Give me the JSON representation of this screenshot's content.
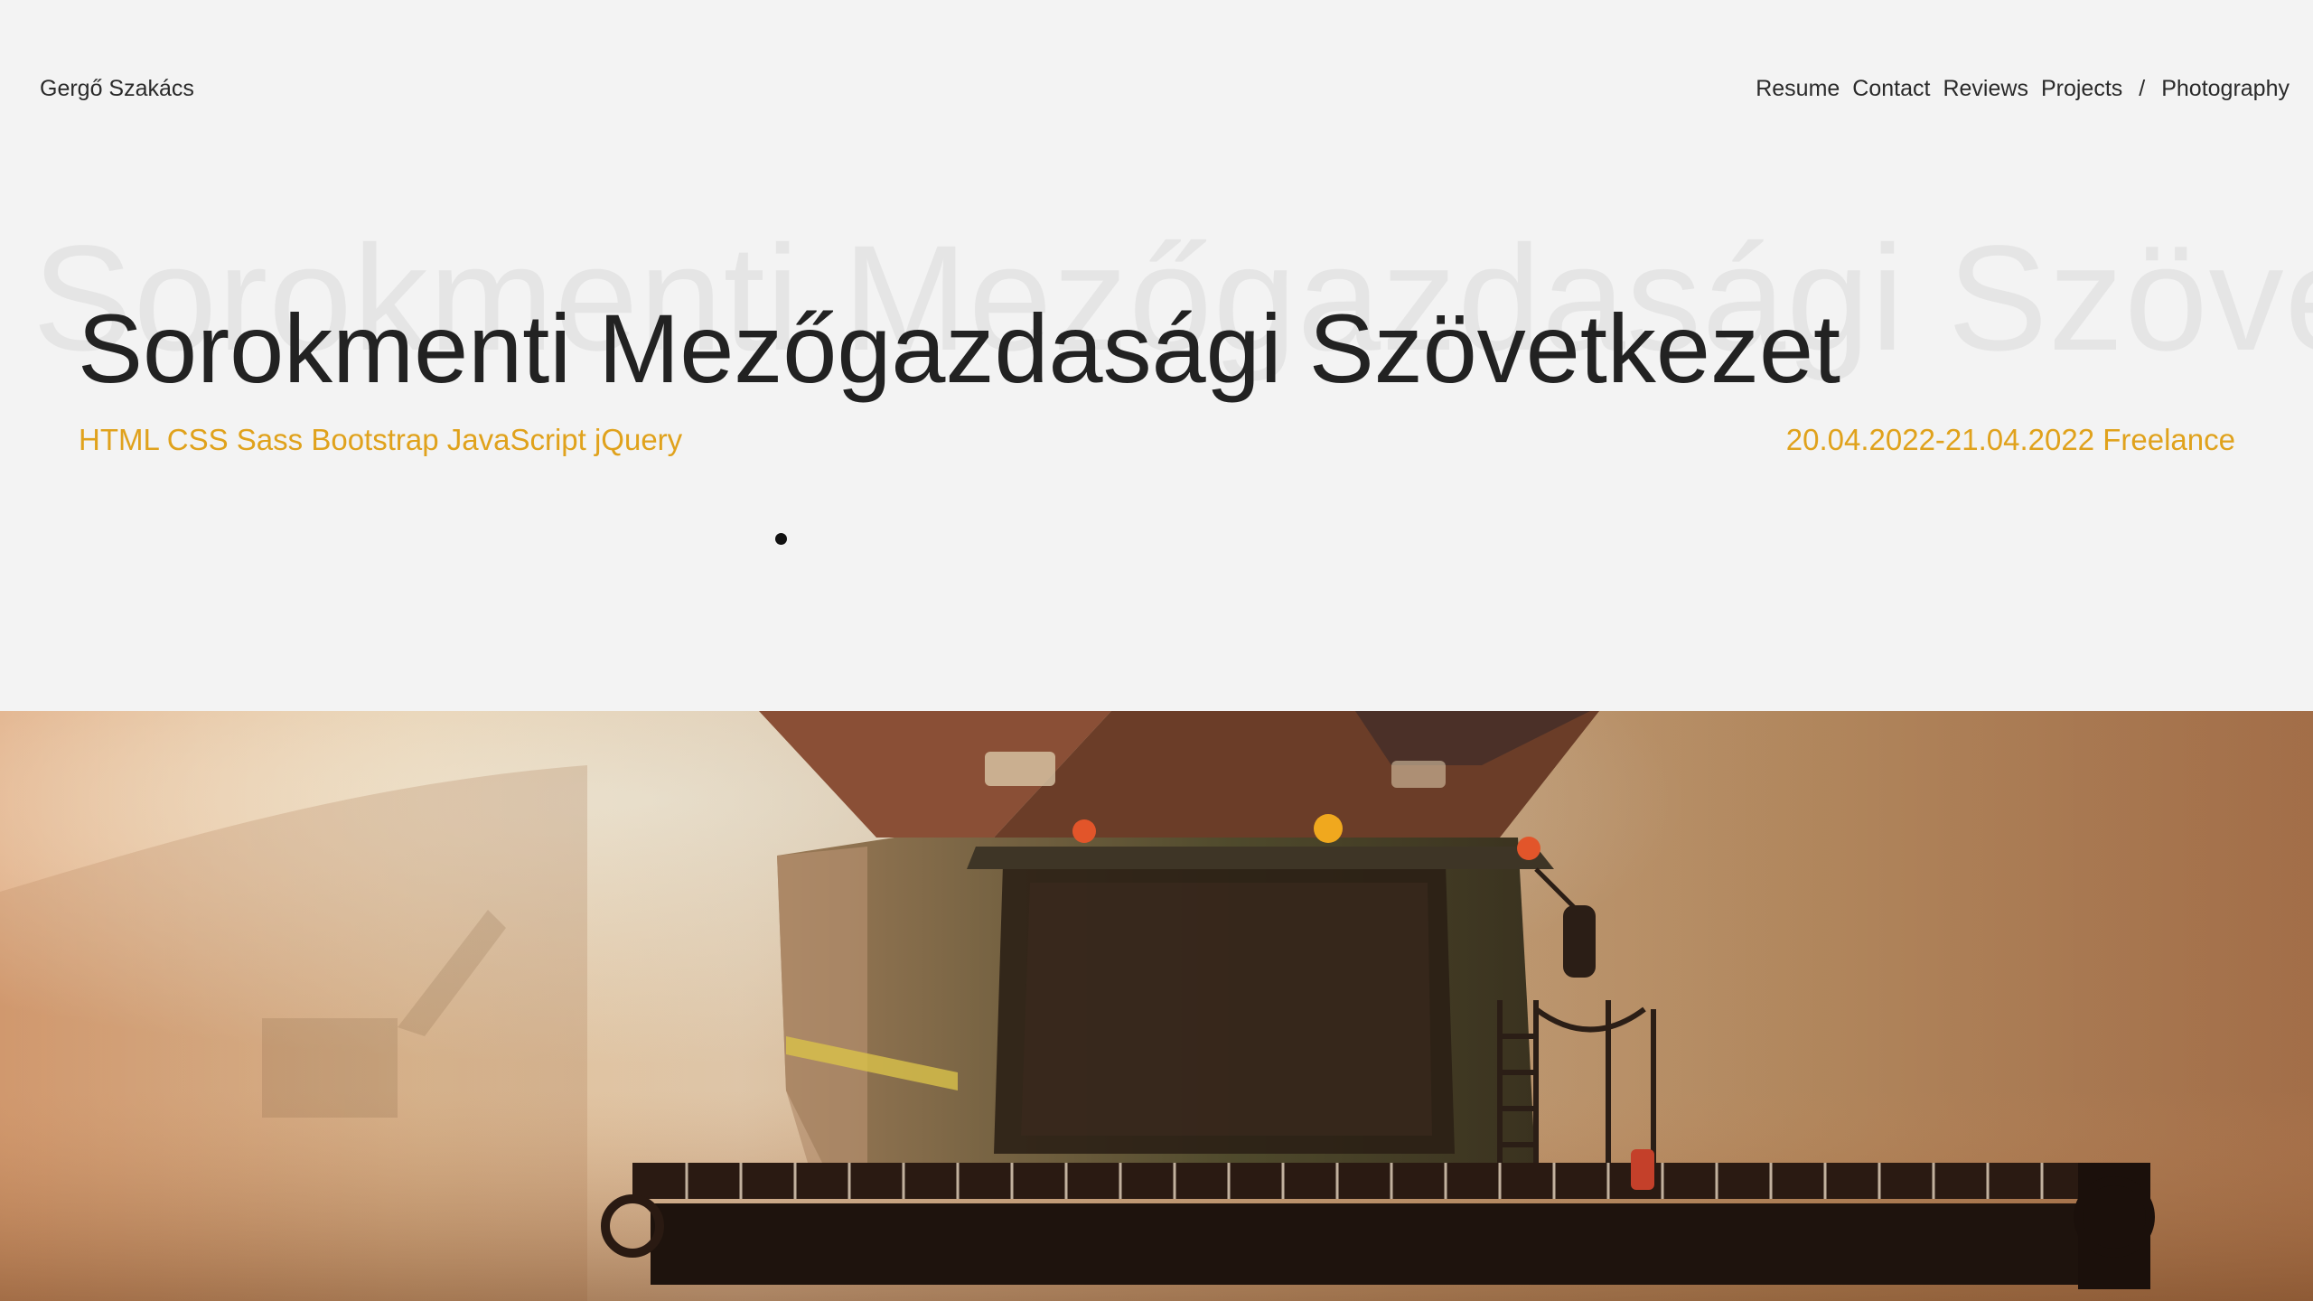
{
  "header": {
    "brand": "Gergő Szakács",
    "nav": [
      {
        "label": "Resume"
      },
      {
        "label": "Contact"
      },
      {
        "label": "Reviews"
      },
      {
        "label": "Projects"
      },
      {
        "label": "/"
      },
      {
        "label": "Photography"
      }
    ]
  },
  "project": {
    "ghost_title": "Sorokmenti Mezőgazdasági Szövetkezet",
    "title": "Sorokmenti Mezőgazdasági Szövetkezet",
    "technologies": "HTML CSS Sass Bootstrap JavaScript jQuery",
    "dates_type": "20.04.2022-21.04.2022 Freelance"
  },
  "hero": {
    "subject": "combine harvester in a dusty wheat field at sunset"
  },
  "colors": {
    "background": "#f3f3f3",
    "accent": "#e0a21c",
    "title": "#222222",
    "ghost": "#e5e5e5"
  }
}
